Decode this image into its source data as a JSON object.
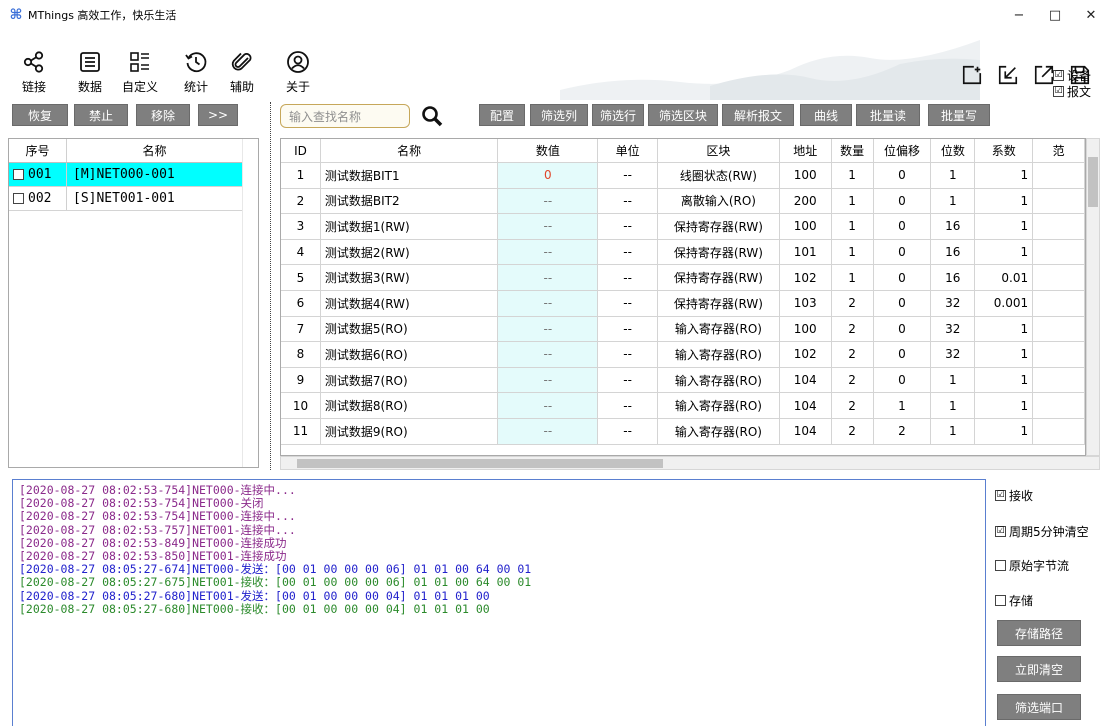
{
  "window": {
    "title": "MThings  高效工作，快乐生活",
    "controls": {
      "minimize": "−",
      "maximize": "□",
      "close": "✕"
    }
  },
  "ribbon": {
    "items": [
      {
        "label": "链接",
        "icon": "share-nodes-icon"
      },
      {
        "label": "数据",
        "icon": "document-list-icon"
      },
      {
        "label": "自定义",
        "icon": "grid-list-icon"
      },
      {
        "label": "统计",
        "icon": "history-clock-icon"
      },
      {
        "label": "辅助",
        "icon": "paperclip-icon"
      },
      {
        "label": "关于",
        "icon": "user-circle-icon"
      }
    ],
    "right_icons": [
      "add-window-icon",
      "collapse-arrow-icon",
      "expand-arrow-icon",
      "save-icon"
    ],
    "checks": [
      {
        "label": "设备",
        "checked": true
      },
      {
        "label": "报文",
        "checked": true
      }
    ]
  },
  "left_toolbar": [
    "恢复",
    "禁止",
    "移除",
    ">>"
  ],
  "main_toolbar": {
    "search_placeholder": "输入查找名称",
    "buttons": [
      "配置",
      "筛选列",
      "筛选行",
      "筛选区块",
      "解析报文",
      "曲线",
      "批量读",
      "批量写"
    ]
  },
  "device_table": {
    "headers": [
      "序号",
      "名称"
    ],
    "rows": [
      {
        "no": "001",
        "name": "[M]NET000-001",
        "selected": true
      },
      {
        "no": "002",
        "name": "[S]NET001-001",
        "selected": false
      }
    ]
  },
  "data_table": {
    "headers": [
      "ID",
      "名称",
      "数值",
      "单位",
      "区块",
      "地址",
      "数量",
      "位偏移",
      "位数",
      "系数",
      "范"
    ],
    "rows": [
      [
        "1",
        "测试数据BIT1",
        "0",
        "--",
        "线圈状态(RW)",
        "100",
        "1",
        "0",
        "1",
        "1"
      ],
      [
        "2",
        "测试数据BIT2",
        "--",
        "--",
        "离散输入(RO)",
        "200",
        "1",
        "0",
        "1",
        "1"
      ],
      [
        "3",
        "测试数据1(RW)",
        "--",
        "--",
        "保持寄存器(RW)",
        "100",
        "1",
        "0",
        "16",
        "1"
      ],
      [
        "4",
        "测试数据2(RW)",
        "--",
        "--",
        "保持寄存器(RW)",
        "101",
        "1",
        "0",
        "16",
        "1"
      ],
      [
        "5",
        "测试数据3(RW)",
        "--",
        "--",
        "保持寄存器(RW)",
        "102",
        "1",
        "0",
        "16",
        "0.01"
      ],
      [
        "6",
        "测试数据4(RW)",
        "--",
        "--",
        "保持寄存器(RW)",
        "103",
        "2",
        "0",
        "32",
        "0.001"
      ],
      [
        "7",
        "测试数据5(RO)",
        "--",
        "--",
        "输入寄存器(RO)",
        "100",
        "2",
        "0",
        "32",
        "1"
      ],
      [
        "8",
        "测试数据6(RO)",
        "--",
        "--",
        "输入寄存器(RO)",
        "102",
        "2",
        "0",
        "32",
        "1"
      ],
      [
        "9",
        "测试数据7(RO)",
        "--",
        "--",
        "输入寄存器(RO)",
        "104",
        "2",
        "0",
        "1",
        "1"
      ],
      [
        "10",
        "测试数据8(RO)",
        "--",
        "--",
        "输入寄存器(RO)",
        "104",
        "2",
        "1",
        "1",
        "1"
      ],
      [
        "11",
        "测试数据9(RO)",
        "--",
        "--",
        "输入寄存器(RO)",
        "104",
        "2",
        "2",
        "1",
        "1"
      ]
    ]
  },
  "log": {
    "lines": [
      {
        "text": "[2020-08-27 08:02:53-754]NET000-连接中...",
        "color": "#8b2a8b"
      },
      {
        "text": "[2020-08-27 08:02:53-754]NET000-关闭",
        "color": "#8b2a8b"
      },
      {
        "text": "[2020-08-27 08:02:53-754]NET000-连接中...",
        "color": "#8b2a8b"
      },
      {
        "text": "[2020-08-27 08:02:53-757]NET001-连接中...",
        "color": "#8b2a8b"
      },
      {
        "text": "[2020-08-27 08:02:53-849]NET000-连接成功",
        "color": "#8b2a8b"
      },
      {
        "text": "[2020-08-27 08:02:53-850]NET001-连接成功",
        "color": "#8b2a8b"
      },
      {
        "text": "[2020-08-27 08:05:27-674]NET000-发送：[00 01 00 00 00 06] 01 01 00 64 00 01",
        "color": "#2222cc"
      },
      {
        "text": "[2020-08-27 08:05:27-675]NET001-接收：[00 01 00 00 00 06] 01 01 00 64 00 01",
        "color": "#2b8a2b"
      },
      {
        "text": "[2020-08-27 08:05:27-680]NET001-发送：[00 01 00 00 00 04] 01 01 01 00",
        "color": "#2222cc"
      },
      {
        "text": "[2020-08-27 08:05:27-680]NET000-接收：[00 01 00 00 00 04] 01 01 01 00",
        "color": "#2b8a2b"
      }
    ]
  },
  "right_panel": {
    "checks": [
      {
        "label": "接收",
        "checked": true
      },
      {
        "label": "周期5分钟清空",
        "checked": true
      },
      {
        "label": "原始字节流",
        "checked": false
      },
      {
        "label": "存储",
        "checked": false
      }
    ],
    "buttons": [
      "存储路径",
      "立即清空",
      "筛选端口"
    ]
  }
}
